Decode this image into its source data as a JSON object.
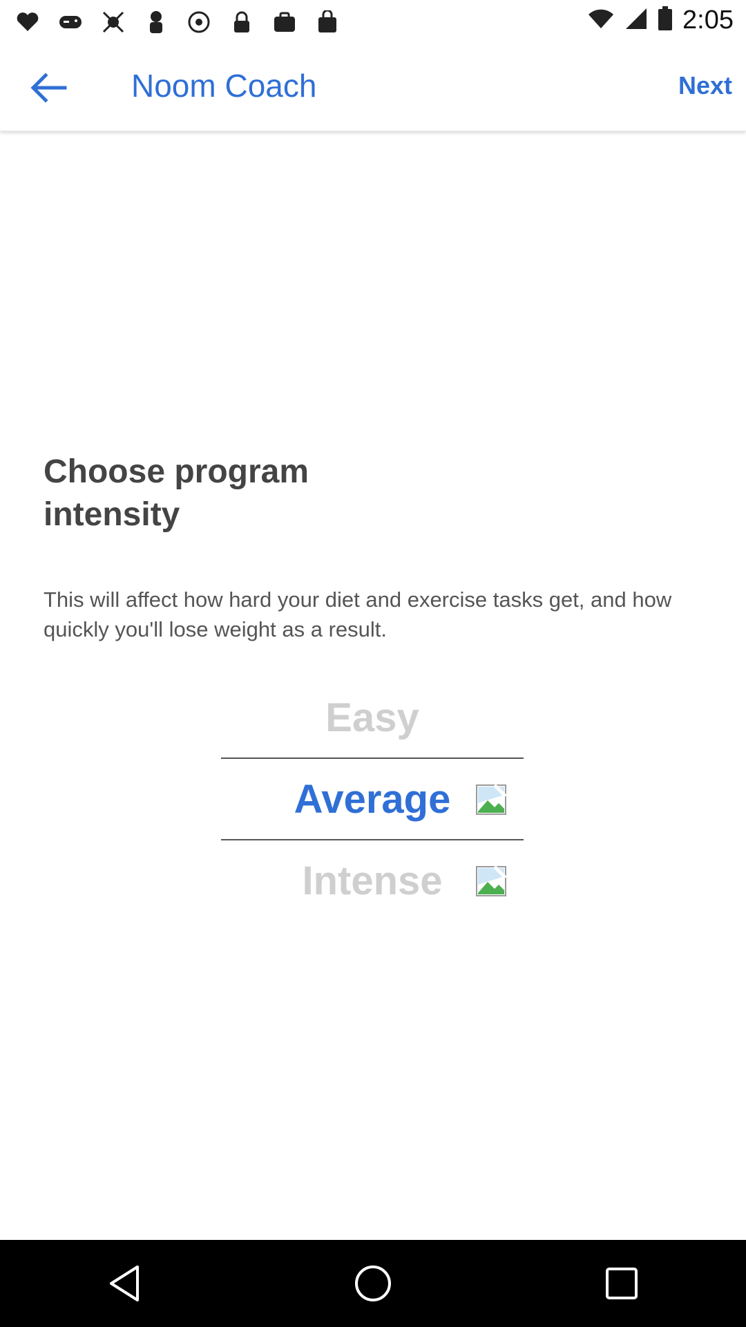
{
  "status_bar": {
    "time": "2:05",
    "icons": [
      "notification-icon",
      "gamepad-icon",
      "fake-gps-icon",
      "security-icon",
      "speed-icon",
      "lock-icon",
      "toolbox-icon",
      "shopping-bag-icon",
      "wifi-icon",
      "signal-icon",
      "battery-icon"
    ]
  },
  "app_bar": {
    "title": "Noom Coach",
    "next_label": "Next"
  },
  "content": {
    "heading": "Choose program intensity",
    "description": "This will affect how hard your diet and exercise tasks get, and how quickly you'll lose weight as a result."
  },
  "intensity_picker": {
    "options": [
      {
        "label": "Easy",
        "state": "faded"
      },
      {
        "label": "Average",
        "state": "selected"
      },
      {
        "label": "Intense",
        "state": "faded"
      }
    ],
    "selected": "Average"
  },
  "colors": {
    "accent": "#2f6fd6",
    "faded": "#cfcfcf",
    "text": "#444444"
  }
}
